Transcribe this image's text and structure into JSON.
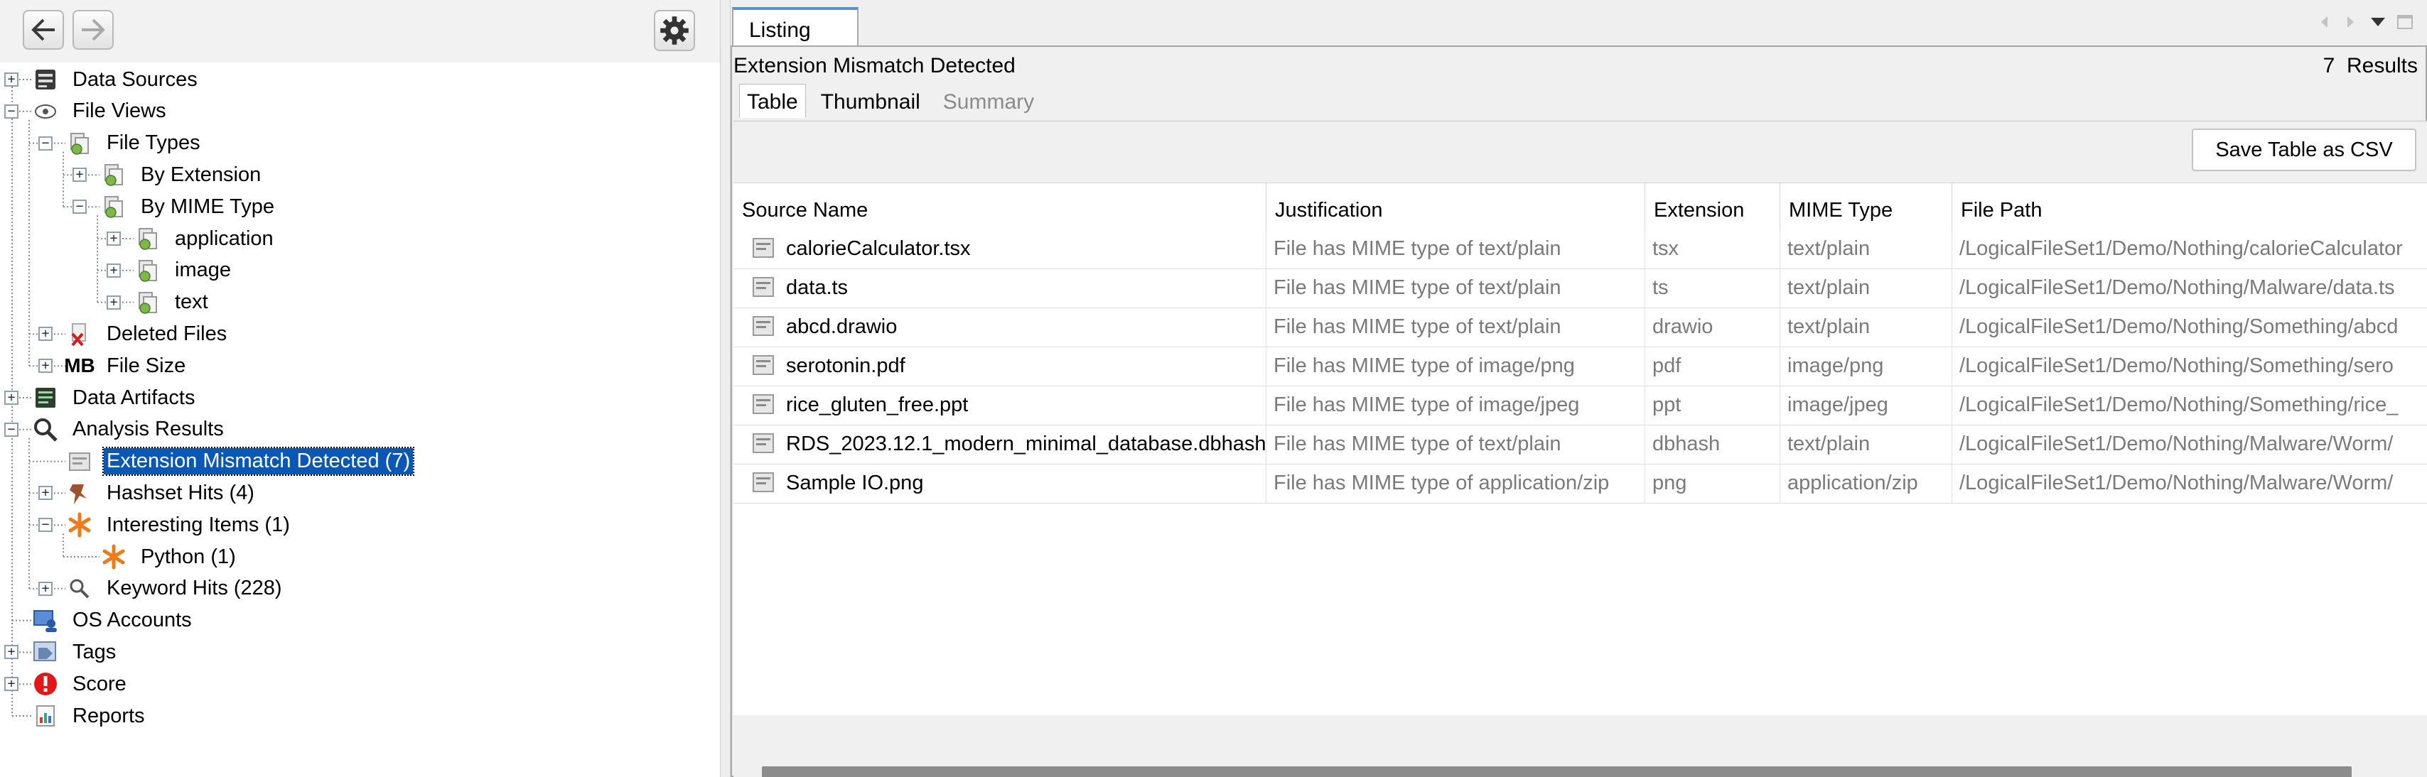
{
  "left": {
    "tree": [
      {
        "id": "data-sources",
        "label": "Data Sources",
        "icon": "data-sources-icon",
        "toggle": "+"
      },
      {
        "id": "file-views",
        "label": "File Views",
        "icon": "eye-icon",
        "toggle": "−"
      },
      {
        "id": "file-types",
        "label": "File Types",
        "icon": "file-types-icon",
        "toggle": "−"
      },
      {
        "id": "by-extension",
        "label": "By Extension",
        "icon": "file-types-icon",
        "toggle": "+"
      },
      {
        "id": "by-mime-type",
        "label": "By MIME Type",
        "icon": "file-types-icon",
        "toggle": "−"
      },
      {
        "id": "application",
        "label": "application",
        "icon": "file-types-icon",
        "toggle": "+"
      },
      {
        "id": "image",
        "label": "image",
        "icon": "file-types-icon",
        "toggle": "+"
      },
      {
        "id": "text",
        "label": "text",
        "icon": "file-types-icon",
        "toggle": "+"
      },
      {
        "id": "deleted-files",
        "label": "Deleted Files",
        "icon": "deleted-file-icon",
        "toggle": "+"
      },
      {
        "id": "file-size",
        "label": "File Size",
        "icon": "mb-icon",
        "icon_text": "MB",
        "toggle": "+"
      },
      {
        "id": "data-artifacts",
        "label": "Data Artifacts",
        "icon": "data-artifacts-icon",
        "toggle": "+"
      },
      {
        "id": "analysis-results",
        "label": "Analysis Results",
        "icon": "magnifier-icon",
        "toggle": "−"
      },
      {
        "id": "extension-mismatch",
        "label": "Extension Mismatch Detected (7)",
        "icon": "mismatch-file-icon",
        "toggle": ""
      },
      {
        "id": "hashset-hits",
        "label": "Hashset Hits (4)",
        "icon": "hashset-pin-icon",
        "toggle": "+"
      },
      {
        "id": "interesting-items",
        "label": "Interesting Items (1)",
        "icon": "asterisk-icon",
        "toggle": "−"
      },
      {
        "id": "python",
        "label": "Python (1)",
        "icon": "asterisk-icon",
        "toggle": ""
      },
      {
        "id": "keyword-hits",
        "label": "Keyword Hits (228)",
        "icon": "small-magnifier-icon",
        "toggle": "+"
      },
      {
        "id": "os-accounts",
        "label": "OS Accounts",
        "icon": "os-accounts-icon",
        "toggle": ""
      },
      {
        "id": "tags",
        "label": "Tags",
        "icon": "tag-icon",
        "toggle": "+"
      },
      {
        "id": "score",
        "label": "Score",
        "icon": "alert-icon",
        "toggle": "+"
      },
      {
        "id": "reports",
        "label": "Reports",
        "icon": "report-icon",
        "toggle": ""
      }
    ],
    "selected": "extension-mismatch"
  },
  "right": {
    "tab_label": "Listing",
    "title": "Extension Mismatch Detected",
    "results": "7  Results",
    "sub_tabs": [
      "Table",
      "Thumbnail",
      "Summary"
    ],
    "save_button": "Save Table as CSV",
    "columns": [
      "Source Name",
      "Justification",
      "Extension",
      "MIME Type",
      "File Path"
    ],
    "rows": [
      [
        "calorieCalculator.tsx",
        "File has MIME type of text/plain",
        "tsx",
        "text/plain",
        "/LogicalFileSet1/Demo/Nothing/calorieCalculator"
      ],
      [
        "data.ts",
        "File has MIME type of text/plain",
        "ts",
        "text/plain",
        "/LogicalFileSet1/Demo/Nothing/Malware/data.ts"
      ],
      [
        "abcd.drawio",
        "File has MIME type of text/plain",
        "drawio",
        "text/plain",
        "/LogicalFileSet1/Demo/Nothing/Something/abcd"
      ],
      [
        "serotonin.pdf",
        "File has MIME type of image/png",
        "pdf",
        "image/png",
        "/LogicalFileSet1/Demo/Nothing/Something/sero"
      ],
      [
        "rice_gluten_free.ppt",
        "File has MIME type of image/jpeg",
        "ppt",
        "image/jpeg",
        "/LogicalFileSet1/Demo/Nothing/Something/rice_"
      ],
      [
        "RDS_2023.12.1_modern_minimal_database.dbhash",
        "File has MIME type of text/plain",
        "dbhash",
        "text/plain",
        "/LogicalFileSet1/Demo/Nothing/Malware/Worm/"
      ],
      [
        "Sample IO.png",
        "File has MIME type of application/zip",
        "png",
        "application/zip",
        "/LogicalFileSet1/Demo/Nothing/Malware/Worm/"
      ]
    ]
  }
}
